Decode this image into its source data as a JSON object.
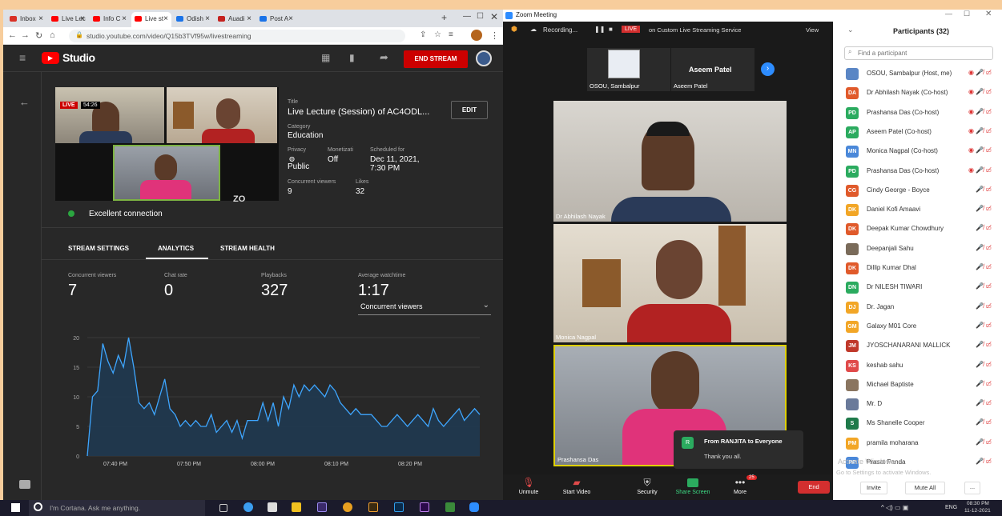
{
  "chrome": {
    "tabs": [
      {
        "label": "Inbox",
        "color": "#d93025"
      },
      {
        "label": "Live Lec",
        "color": "#ff0000"
      },
      {
        "label": "Info C",
        "color": "#ff0000"
      },
      {
        "label": "Live st",
        "color": "#ff0000"
      },
      {
        "label": "Odish",
        "color": "#1a73e8"
      },
      {
        "label": "Auadi",
        "color": "#c5221f"
      },
      {
        "label": "Post A",
        "color": "#1a73e8"
      }
    ],
    "url": "studio.youtube.com/video/Q15b3TVf95w/livestreaming"
  },
  "studio": {
    "logo": "Studio",
    "end_stream": "END STREAM",
    "live_badge": "LIVE",
    "timer": "54:26",
    "title_label": "Title",
    "title": "Live Lecture (Session) of AC4ODL...",
    "edit": "EDIT",
    "category_label": "Category",
    "category": "Education",
    "privacy_label": "Privacy",
    "privacy": "Public",
    "monetization_label": "Monetizati",
    "monetization": "Off",
    "scheduled_label": "Scheduled for",
    "scheduled_date": "Dec 11, 2021,",
    "scheduled_time": "7:30 PM",
    "concurrent_label": "Concurrent viewers",
    "concurrent": "9",
    "likes_label": "Likes",
    "likes": "32",
    "connection": "Excellent connection",
    "tabs": [
      "STREAM SETTINGS",
      "ANALYTICS",
      "STREAM HEALTH"
    ],
    "stats": [
      {
        "label": "Concurrent viewers",
        "value": "7"
      },
      {
        "label": "Chat rate",
        "value": "0"
      },
      {
        "label": "Playbacks",
        "value": "327"
      },
      {
        "label": "Average watchtime",
        "value": "1:17"
      }
    ],
    "dropdown": "Concurrent viewers"
  },
  "chart_data": {
    "type": "area",
    "ylim": [
      0,
      20
    ],
    "y_ticks": [
      "20",
      "15",
      "10",
      "5",
      "0"
    ],
    "x_ticks": [
      "07:40 PM",
      "07:50 PM",
      "08:00 PM",
      "08:10 PM",
      "08:20 PM"
    ],
    "values": [
      0,
      10,
      11,
      19,
      16,
      14,
      17,
      15,
      20,
      15,
      9,
      8,
      9,
      7,
      10,
      13,
      8,
      7,
      5,
      6,
      5,
      6,
      5,
      5,
      7,
      4,
      5,
      6,
      4,
      6,
      3,
      6,
      6,
      6,
      9,
      6,
      9,
      5,
      10,
      8,
      12,
      10,
      12,
      11,
      12,
      11,
      10,
      12,
      11,
      9,
      8,
      7,
      8,
      7,
      7,
      7,
      6,
      5,
      5,
      6,
      7,
      6,
      5,
      6,
      7,
      6,
      5,
      8,
      6,
      5,
      6,
      7,
      8,
      6,
      7,
      8,
      7
    ],
    "color": "#3ea6ff"
  },
  "zoom": {
    "title": "Zoom Meeting",
    "recording": "Recording...",
    "live": "LIVE",
    "service": "on Custom Live Streaming Service",
    "view": "View",
    "top_tiles": [
      "OSOU, Sambalpur",
      "Aseem Patel"
    ],
    "aseem_name": "Aseem Patel",
    "tiles": [
      "Dr Abhilash Nayak",
      "Monica Nagpal",
      "Prashansa Das"
    ],
    "chat_from": "From RANJITA to Everyone",
    "chat_msg": "Thank you all.",
    "chat_initial": "R",
    "toolbar": [
      {
        "label": "Unmute",
        "icon": "mic-off"
      },
      {
        "label": "Start Video",
        "icon": "video-off"
      },
      {
        "label": "Security",
        "icon": "shield"
      },
      {
        "label": "Share Screen",
        "icon": "share"
      },
      {
        "label": "More",
        "icon": "more"
      }
    ],
    "more_badge": "25",
    "end": "End"
  },
  "participants": {
    "title": "Participants (32)",
    "search_placeholder": "Find a participant",
    "list": [
      {
        "initials": "",
        "name": "OSOU, Sambalpur (Host, me)",
        "color": "#5a86c5"
      },
      {
        "initials": "DA",
        "name": "Dr Abhilash Nayak (Co-host)",
        "color": "#e05a2b"
      },
      {
        "initials": "PD",
        "name": "Prashansa Das (Co-host)",
        "color": "#2bab5f"
      },
      {
        "initials": "AP",
        "name": "Aseem Patel (Co-host)",
        "color": "#2bab5f"
      },
      {
        "initials": "MN",
        "name": "Monica Nagpal (Co-host)",
        "color": "#4a88d9"
      },
      {
        "initials": "PD",
        "name": "Prashansa Das (Co-host)",
        "color": "#2bab5f"
      },
      {
        "initials": "CG",
        "name": "Cindy George - Boyce",
        "color": "#e05a2b"
      },
      {
        "initials": "DK",
        "name": "Daniel  Kofi Amaavi",
        "color": "#f2a626"
      },
      {
        "initials": "DK",
        "name": "Deepak Kumar Chowdhury",
        "color": "#e05a2b"
      },
      {
        "initials": "",
        "name": "Deepanjali Sahu",
        "color": "#7a6b5a"
      },
      {
        "initials": "DK",
        "name": "Dillip Kumar Dhal",
        "color": "#e05a2b"
      },
      {
        "initials": "DN",
        "name": "Dr NILESH TIWARI",
        "color": "#2bab5f"
      },
      {
        "initials": "DJ",
        "name": "Dr. Jagan",
        "color": "#f2a626"
      },
      {
        "initials": "GM",
        "name": "Galaxy M01 Core",
        "color": "#f2a626"
      },
      {
        "initials": "JM",
        "name": "JYOSCHANARANI MALLICK",
        "color": "#c0392b"
      },
      {
        "initials": "KS",
        "name": "keshab sahu",
        "color": "#e04a4a"
      },
      {
        "initials": "",
        "name": "Michael Baptiste",
        "color": "#8a7560"
      },
      {
        "initials": "",
        "name": "Mr. D",
        "color": "#6a7a9a"
      },
      {
        "initials": "S",
        "name": "Ms Shanelle Cooper",
        "color": "#1f7a4a"
      },
      {
        "initials": "PM",
        "name": "pramila moharana",
        "color": "#f2a626"
      },
      {
        "initials": "PP",
        "name": "Prasat Panda",
        "color": "#4a88d9"
      }
    ],
    "watermark1": "Activate Windows",
    "watermark2": "Go to Settings to activate Windows.",
    "invite": "Invite",
    "mute_all": "Mute All",
    "more": "..."
  },
  "taskbar": {
    "search": "I'm Cortana. Ask me anything.",
    "lang": "ENG",
    "time": "08:30 PM",
    "date": "11-12-2021"
  }
}
